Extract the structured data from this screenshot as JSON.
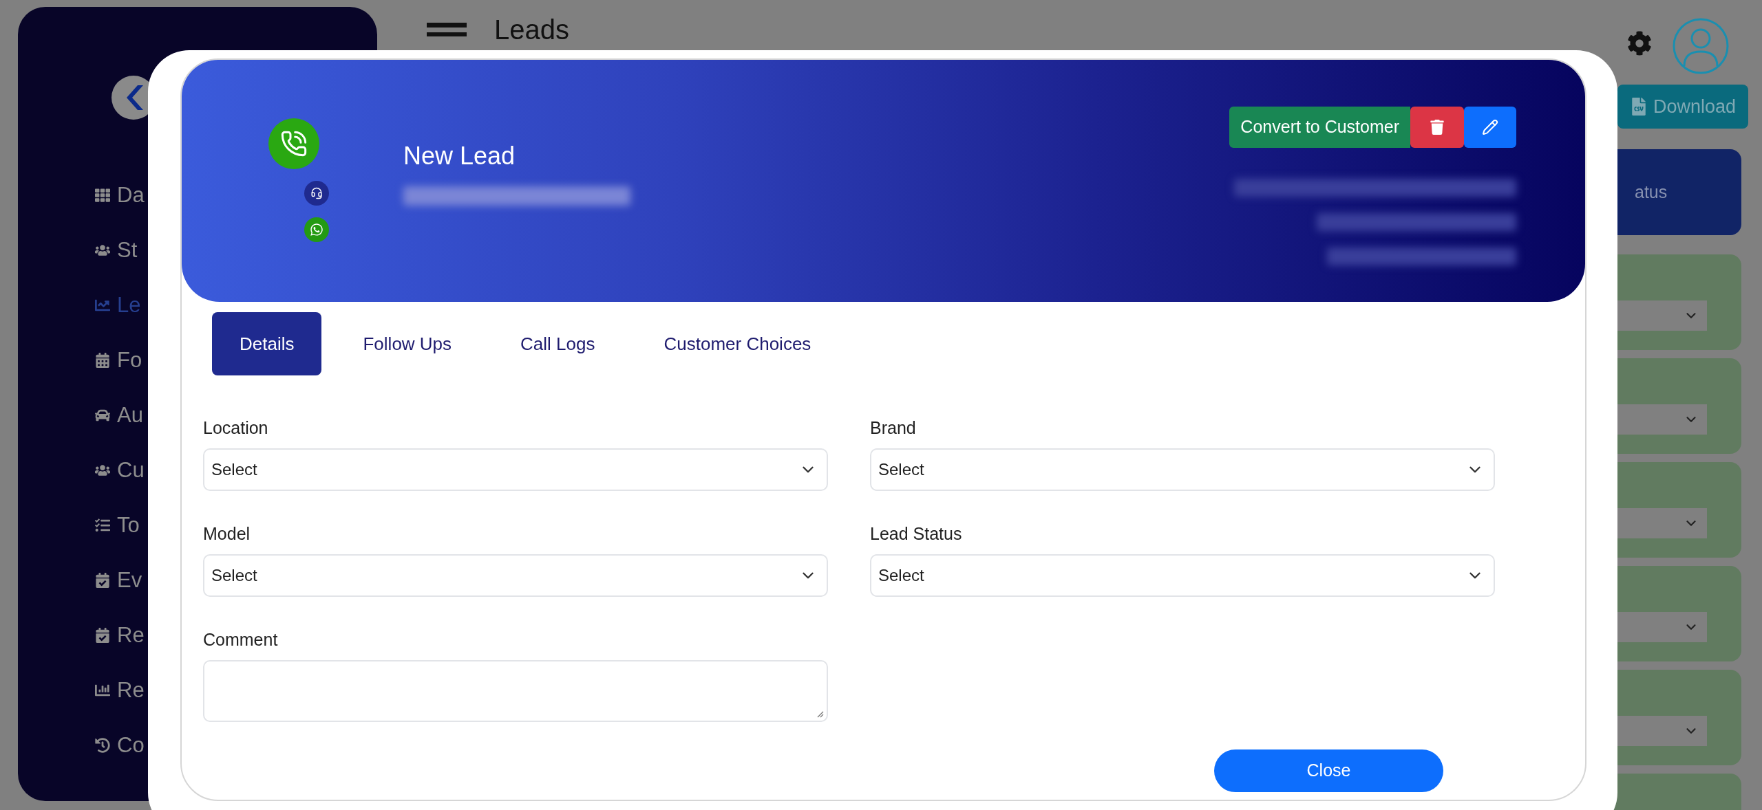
{
  "background": {
    "page_title": "Leads",
    "sidebar_items": [
      {
        "label": "Da",
        "selected": false
      },
      {
        "label": "St",
        "selected": false
      },
      {
        "label": "Le",
        "selected": true
      },
      {
        "label": "Fo",
        "selected": false
      },
      {
        "label": "Au",
        "selected": false
      },
      {
        "label": "Cu",
        "selected": false
      },
      {
        "label": "To",
        "selected": false
      },
      {
        "label": "Ev",
        "selected": false
      },
      {
        "label": "Re",
        "selected": false
      },
      {
        "label": "Re",
        "selected": false
      },
      {
        "label": "Co",
        "selected": false
      }
    ],
    "download_button": "Download",
    "status_card": "atus"
  },
  "modal": {
    "title": "New Lead",
    "convert_button": "Convert to Customer",
    "tabs": [
      {
        "label": "Details",
        "selected": true
      },
      {
        "label": "Follow Ups",
        "selected": false
      },
      {
        "label": "Call Logs",
        "selected": false
      },
      {
        "label": "Customer Choices",
        "selected": false
      }
    ],
    "fields": [
      {
        "label": "Location",
        "kind": "select",
        "value": "Select"
      },
      {
        "label": "Brand",
        "kind": "select",
        "value": "Select"
      },
      {
        "label": "Model",
        "kind": "select",
        "value": "Select"
      },
      {
        "label": "Lead Status",
        "kind": "select",
        "value": "Select"
      },
      {
        "label": "Comment",
        "kind": "textarea"
      }
    ],
    "close_button": "Close"
  }
}
